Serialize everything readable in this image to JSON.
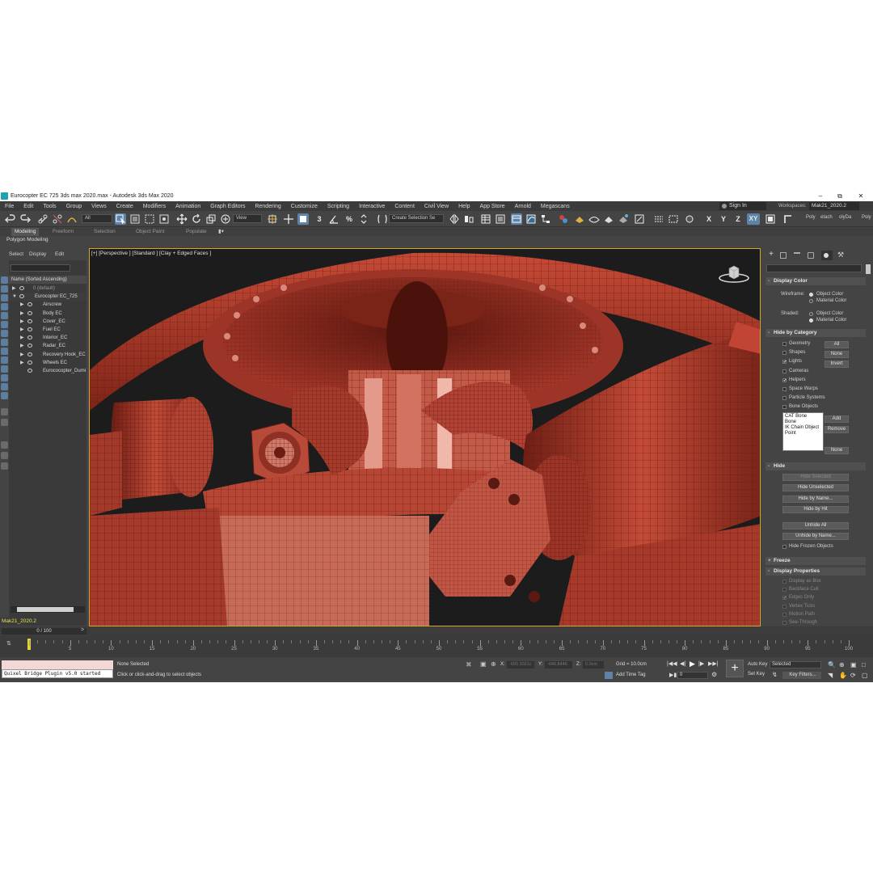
{
  "window": {
    "title": "Eurocopter EC 725 3ds max 2020.max - Autodesk 3ds Max 2020",
    "minimize": "–",
    "maximize": "⧉",
    "close": "✕"
  },
  "menu": {
    "items": [
      "File",
      "Edit",
      "Tools",
      "Group",
      "Views",
      "Create",
      "Modifiers",
      "Animation",
      "Graph Editors",
      "Rendering",
      "Customize",
      "Scripting",
      "Interactive",
      "Content",
      "Civil View",
      "Help",
      "App Store",
      "Arnold",
      "Megascans"
    ],
    "sign_in": "Sign In",
    "workspaces_label": "Workspaces:",
    "workspace_value": "Mak21_2020.2"
  },
  "toolbar": {
    "selection_filter": "All",
    "ref_coord": "View",
    "named_selection": "Create Selection Se",
    "axis_x": "X",
    "axis_y": "Y",
    "axis_z": "Z",
    "axis_xy": "XY",
    "extra_1": "Poly",
    "extra_2": "etach",
    "extra_3": "olyDa",
    "extra_4": "Poly"
  },
  "ribbon": {
    "tabs": [
      "Modeling",
      "Freeform",
      "Selection",
      "Object Paint",
      "Populate"
    ],
    "active_tab": "Modeling",
    "sub_label": "Polygon Modeling"
  },
  "explorer": {
    "menu": [
      "Select",
      "Display",
      "Edit"
    ],
    "header": "Name (Sorted Ascending)",
    "rows": [
      {
        "label": "0 (default)",
        "indent": 0,
        "dim": true,
        "arrow": "▶"
      },
      {
        "label": "Eurocopter EC_725",
        "indent": 0,
        "dim": false,
        "arrow": "▼"
      },
      {
        "label": "Airscrew",
        "indent": 1,
        "dim": false,
        "arrow": "▶"
      },
      {
        "label": "Body EC",
        "indent": 1,
        "dim": false,
        "arrow": "▶"
      },
      {
        "label": "Cover_EC",
        "indent": 1,
        "dim": false,
        "arrow": "▶"
      },
      {
        "label": "Fuel EC",
        "indent": 1,
        "dim": false,
        "arrow": "▶"
      },
      {
        "label": "Interior_EC",
        "indent": 1,
        "dim": false,
        "arrow": "▶"
      },
      {
        "label": "Radar_EC",
        "indent": 1,
        "dim": false,
        "arrow": "▶"
      },
      {
        "label": "Recovery Hook_EC",
        "indent": 1,
        "dim": false,
        "arrow": "▶"
      },
      {
        "label": "Wheels EC",
        "indent": 1,
        "dim": false,
        "arrow": "▶"
      },
      {
        "label": "Eurococopter_Dumi",
        "indent": 1,
        "dim": false,
        "arrow": ""
      }
    ],
    "layer": "Mak21_2020.2"
  },
  "viewport": {
    "label": "[+] [Perspective ] [Standard ] [Clay + Edged Faces ]"
  },
  "command_panel": {
    "display_color": {
      "title": "Display Color",
      "wireframe_label": "Wireframe:",
      "shaded_label": "Shaded:",
      "object_color": "Object Color",
      "material_color": "Material Color"
    },
    "hide_by_category": {
      "title": "Hide by Category",
      "items": [
        {
          "label": "Geometry",
          "checked": false
        },
        {
          "label": "Shapes",
          "checked": false
        },
        {
          "label": "Lights",
          "checked": true
        },
        {
          "label": "Cameras",
          "checked": false
        },
        {
          "label": "Helpers",
          "checked": true
        },
        {
          "label": "Space Warps",
          "checked": false
        },
        {
          "label": "Particle Systems",
          "checked": false
        },
        {
          "label": "Bone Objects",
          "checked": false
        }
      ],
      "btn_all": "All",
      "btn_none": "None",
      "btn_invert": "Invert",
      "list": [
        "CAT Bone",
        "Bone",
        "IK Chain Object",
        "Point"
      ],
      "btn_add": "Add",
      "btn_remove": "Remove",
      "btn_none2": "None"
    },
    "hide": {
      "title": "Hide",
      "buttons": [
        "Hide Selected",
        "Hide Unselected",
        "Hide by Name...",
        "Hide by Hit",
        "Unhide All",
        "Unhide by Name..."
      ],
      "hide_frozen": "Hide Frozen Objects"
    },
    "freeze": {
      "title": "Freeze"
    },
    "display_properties": {
      "title": "Display Properties",
      "items": [
        {
          "label": "Display as Box",
          "checked": false
        },
        {
          "label": "Backface Cull",
          "checked": false
        },
        {
          "label": "Edges Only",
          "checked": true
        },
        {
          "label": "Vertex Ticks",
          "checked": false
        },
        {
          "label": "Motion Path",
          "checked": false
        },
        {
          "label": "See-Through",
          "checked": false
        }
      ]
    }
  },
  "timeline": {
    "frame": "0 / 100",
    "ticks": [
      5,
      10,
      15,
      20,
      25,
      30,
      35,
      40,
      45,
      50,
      55,
      60,
      65,
      70,
      75,
      80,
      85,
      90,
      95,
      100
    ]
  },
  "status": {
    "maxscript_output": "Quixel Bridge Plugin v5.0 started",
    "selection": "None Selected",
    "prompt": "Click or click-and-drag to select objects",
    "x_label": "X:",
    "x_value": "-600.3021c",
    "y_label": "Y:",
    "y_value": "-646.8446",
    "z_label": "Z:",
    "z_value": "0.0cm",
    "grid": "Grid = 10.0cm",
    "add_time_tag": "Add Time Tag",
    "frame_field": "0",
    "auto_key": "Auto Key",
    "set_key": "Set Key",
    "key_mode": "Selected",
    "key_filters": "Key Filters..."
  },
  "colors": {
    "model_red": "#b03a2a",
    "viewport_border": "#d4a72c",
    "active_blue": "#5f83a8"
  }
}
